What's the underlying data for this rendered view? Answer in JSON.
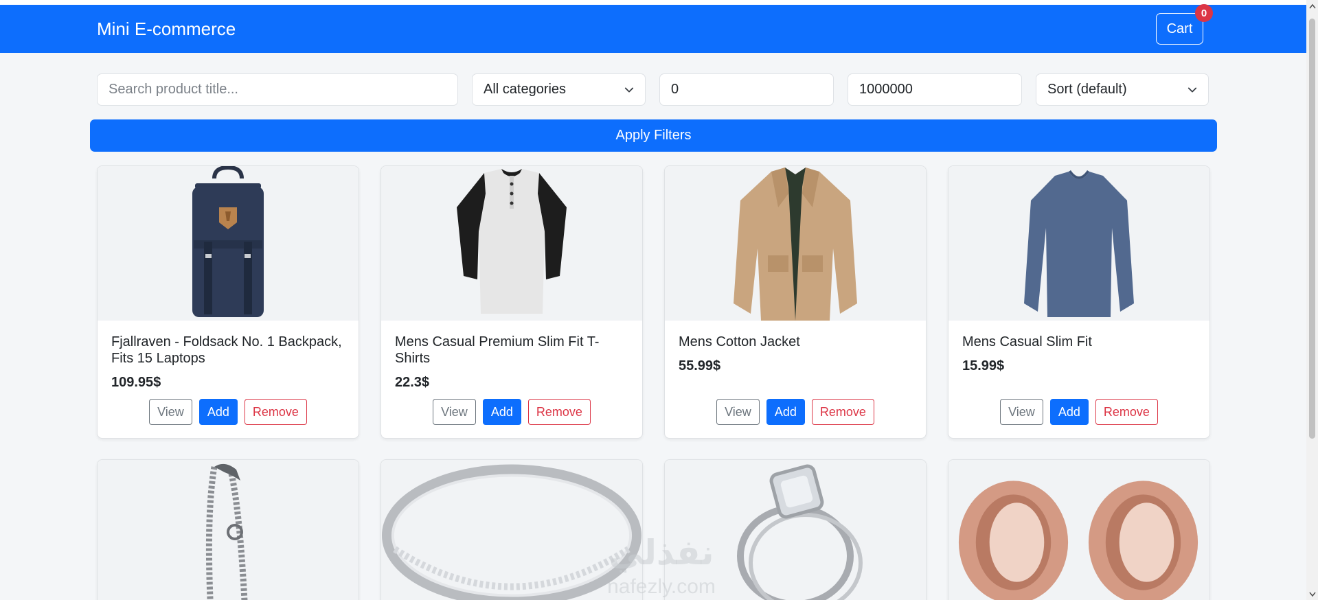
{
  "header": {
    "brand": "Mini E-commerce",
    "cart_label": "Cart",
    "cart_count": "0"
  },
  "filters": {
    "search_placeholder": "Search product title...",
    "category_selected": "All categories",
    "min_price": "0",
    "max_price": "1000000",
    "sort_selected": "Sort (default)",
    "apply_label": "Apply Filters"
  },
  "buttons": {
    "view": "View",
    "add": "Add",
    "remove": "Remove"
  },
  "products": [
    {
      "title": "Fjallraven - Foldsack No. 1 Backpack, Fits 15 Laptops",
      "price": "109.95$",
      "image": "backpack-image"
    },
    {
      "title": "Mens Casual Premium Slim Fit T-Shirts",
      "price": "22.3$",
      "image": "tshirt-image"
    },
    {
      "title": "Mens Cotton Jacket",
      "price": "55.99$",
      "image": "jacket-image"
    },
    {
      "title": "Mens Casual Slim Fit",
      "price": "15.99$",
      "image": "long-sleeve-shirt-image"
    },
    {
      "image": "bracelet-image"
    },
    {
      "image": "silver-ring-image"
    },
    {
      "image": "engagement-ring-image"
    },
    {
      "image": "rose-gold-tunnel-plugs-image"
    }
  ],
  "watermark": {
    "arabic": "نفذلي",
    "latin": "nafezly.com"
  },
  "colors": {
    "primary": "#0d6efd",
    "danger": "#dc3545",
    "secondary": "#6c757d",
    "page_bg": "#f4f6f8"
  }
}
